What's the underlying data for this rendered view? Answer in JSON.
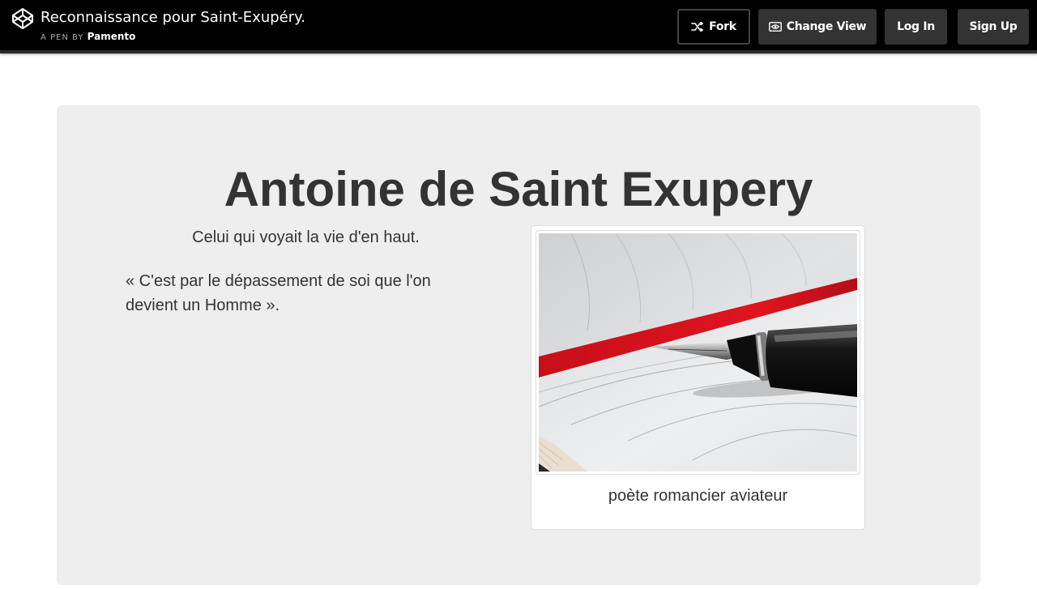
{
  "header": {
    "pen_title": "Reconnaissance pour Saint-Exupéry.",
    "byline_prefix": "A PEN BY",
    "author": "Pamento",
    "logo_icon": "codepen-logo-icon",
    "buttons": {
      "fork": "Fork",
      "change_view": "Change View",
      "log_in": "Log In",
      "sign_up": "Sign Up"
    },
    "fork_icon": "fork-icon",
    "change_view_icon": "eye-icon"
  },
  "page": {
    "title": "Antoine de Saint Exupery",
    "subtitle": "Celui qui voyait la vie d'en haut.",
    "quote": "« C'est par le dépassement de soi que l'on devient un Homme ».",
    "caption": "poète romancier aviateur",
    "image_subject": "fountain-pen-on-notebook"
  },
  "colors": {
    "header_bg": "#000000",
    "button_bg": "#333333",
    "jumbotron_bg": "#eeeeee",
    "text": "#333333",
    "ribbon_red": "#d8121e"
  }
}
